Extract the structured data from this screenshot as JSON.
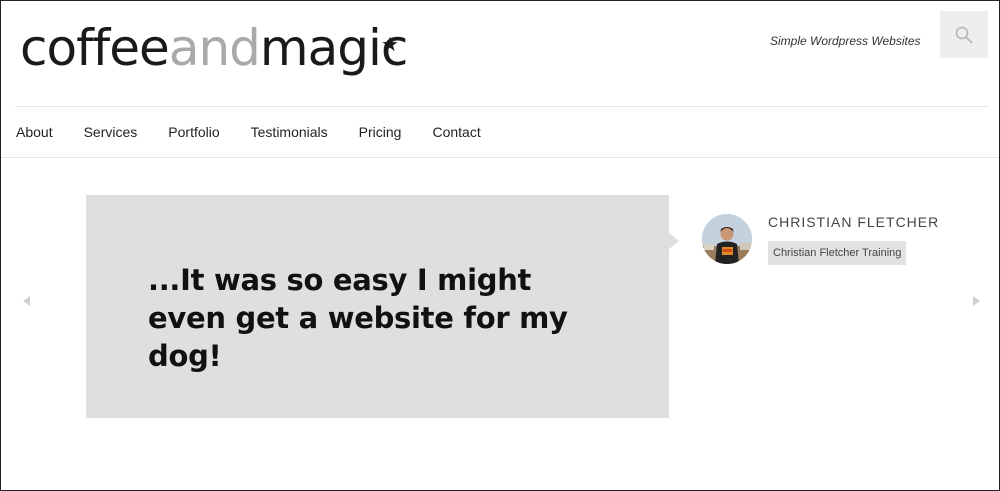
{
  "brand": {
    "logo_part1": "coffee",
    "logo_part2": "and",
    "logo_part3": "magic",
    "logo_star": "★",
    "tagline": "Simple Wordpress Websites"
  },
  "header": {
    "search_icon": "search-icon"
  },
  "nav": {
    "items": [
      "About",
      "Services",
      "Portfolio",
      "Testimonials",
      "Pricing",
      "Contact"
    ]
  },
  "testimonial": {
    "quote": "...It was so easy I might even get a website for my dog!",
    "author_name": "CHRISTIAN FLETCHER",
    "author_company": "Christian Fletcher Training"
  },
  "slider": {
    "prev_icon": "chevron-left-icon",
    "next_icon": "chevron-right-icon"
  },
  "colors": {
    "quote_bg": "#dfdfdf",
    "logo_dark": "#1a1a1a",
    "logo_gray": "#a9a9a9",
    "search_bg": "#eeeeee"
  }
}
